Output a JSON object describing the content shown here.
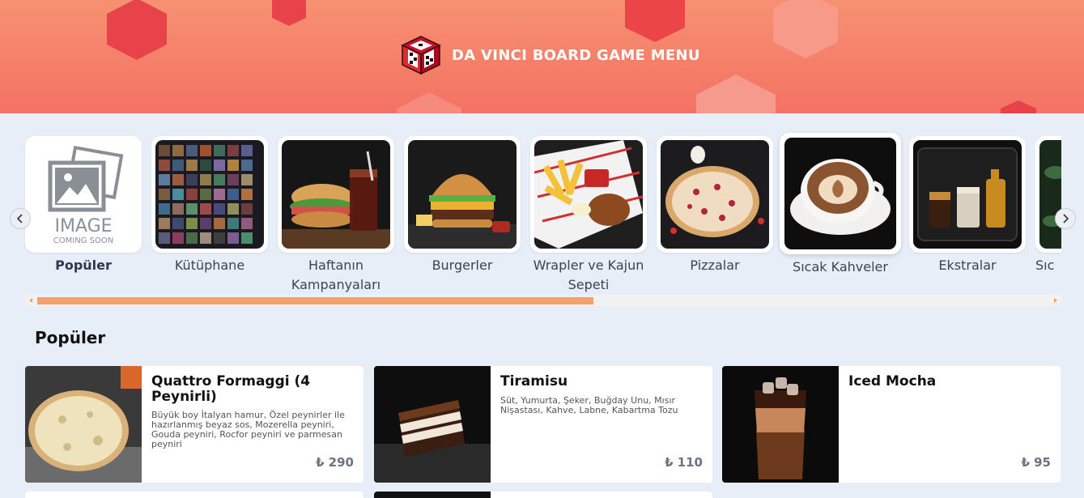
{
  "header": {
    "title": "DA VINCI BOARD GAME MENU",
    "logo_icon": "dice-logo-icon"
  },
  "categories": [
    {
      "label": "Popüler",
      "active": true,
      "image": "image-coming-soon"
    },
    {
      "label": "Kütüphane"
    },
    {
      "label": "Haftanın Kampanyaları"
    },
    {
      "label": "Burgerler"
    },
    {
      "label": "Wrapler ve Kajun Sepeti"
    },
    {
      "label": "Pizzalar"
    },
    {
      "label": "Sıcak Kahveler"
    },
    {
      "label": "Ekstralar"
    },
    {
      "label": "Sıc"
    }
  ],
  "placeholder_image": {
    "line1": "IMAGE",
    "line2": "COMING SOON"
  },
  "nav": {
    "prev_icon": "chevron-left-icon",
    "next_icon": "chevron-right-icon"
  },
  "scrollbar": {
    "position_fraction": 0.54
  },
  "section": {
    "title": "Popüler"
  },
  "products": [
    {
      "name": "Quattro Formaggi (4 Peynirli)",
      "description": "Büyük boy İtalyan hamur, Özel peynirler ile hazırlanmış beyaz sos, Mozerella peyniri, Gouda peyniri, Rocfor peyniri ve parmesan peyniri",
      "price": "₺ 290"
    },
    {
      "name": "Tiramisu",
      "description": "Süt, Yumurta, Şeker, Buğday Unu, Mısır Nişastası, Kahve, Labne, Kabartma Tozu",
      "price": "₺ 110"
    },
    {
      "name": "Iced Mocha",
      "description": "",
      "price": "₺ 95"
    }
  ],
  "colors": {
    "header_top": "#f69170",
    "header_bottom": "#f47264",
    "accent": "#f4a06a",
    "background": "#e8eef8"
  }
}
